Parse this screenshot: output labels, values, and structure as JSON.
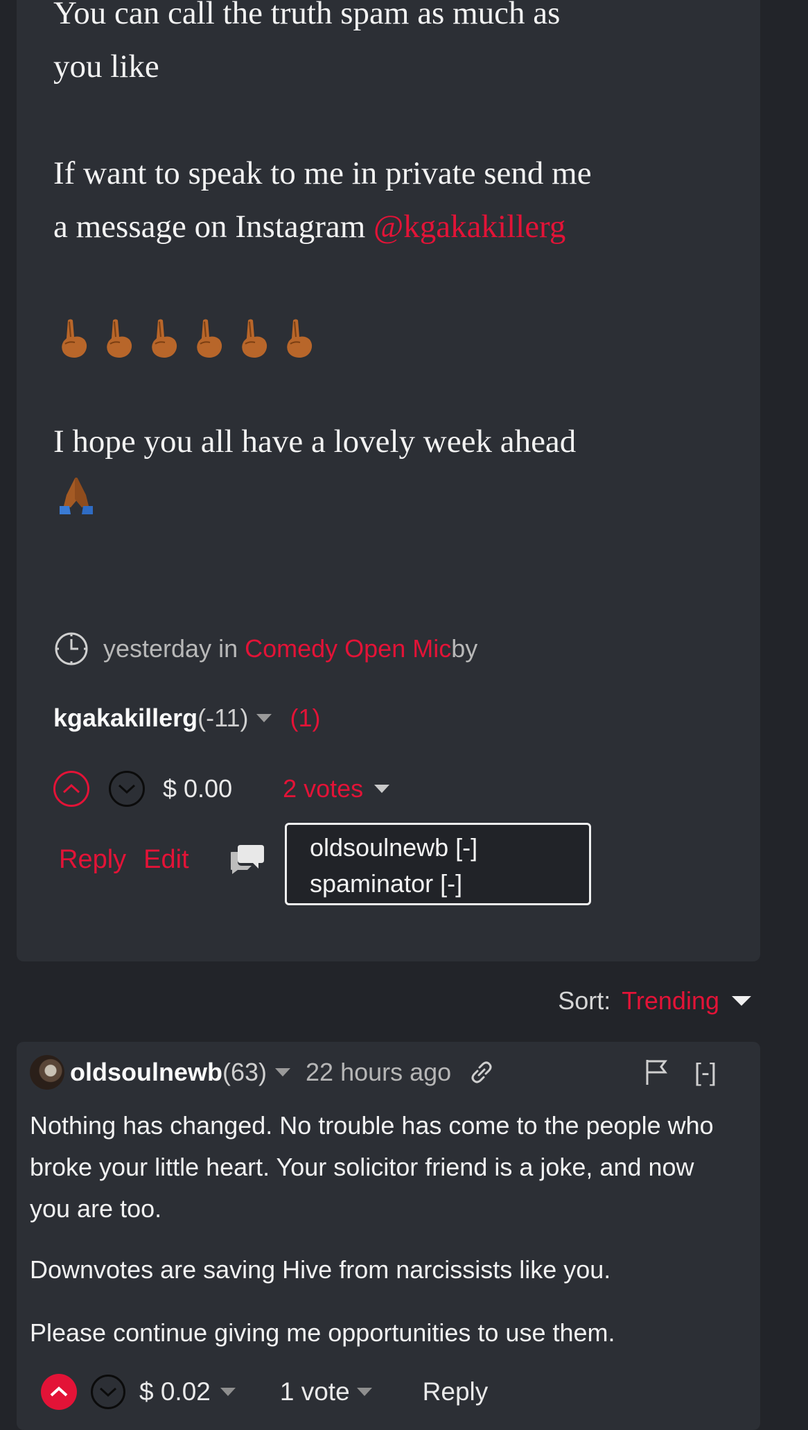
{
  "post": {
    "line_spam_1": "You can call the truth spam as much as",
    "line_spam_2": "you like",
    "line_private_1": "If want to speak to me in private send me",
    "line_private_2": "a message on Instagram ",
    "instagram_handle": "@kgakakillerg",
    "emoji_icon": "index-pointing-up-medium-dark-skin",
    "emoji_count": 6,
    "line_week": "I hope you all have a lovely week ahead",
    "pray_icon": "folded-hands-medium-dark-skin",
    "meta_time": "yesterday in ",
    "meta_community": "Comedy Open Mic",
    "meta_by": " by",
    "author": "kgakakillerg",
    "author_rep": " (-11)",
    "author_badge": "(1)",
    "payout": "$ 0.00",
    "votes": "2 votes",
    "reply_label": "Reply",
    "edit_label": "Edit",
    "voters": [
      "oldsoulnewb [-]",
      "spaminator [-]"
    ]
  },
  "sort": {
    "label": "Sort:",
    "value": "Trending"
  },
  "comment": {
    "author": "oldsoulnewb",
    "author_rep": " (63)",
    "time": "22 hours ago",
    "collapse": "[-]",
    "body_1": "Nothing has changed. No trouble has come to the people who",
    "body_2": "broke your little heart. Your solicitor friend is a joke, and now",
    "body_3": "you are too.",
    "body_4": "Downvotes are saving Hive from narcissists like you.",
    "body_5": "Please continue giving me opportunities to use them.",
    "payout": "$ 0.02",
    "votes": "1 vote",
    "reply_label": "Reply"
  },
  "colors": {
    "accent": "#e31337",
    "card_bg": "#2c2f35",
    "page_bg": "#222429"
  }
}
